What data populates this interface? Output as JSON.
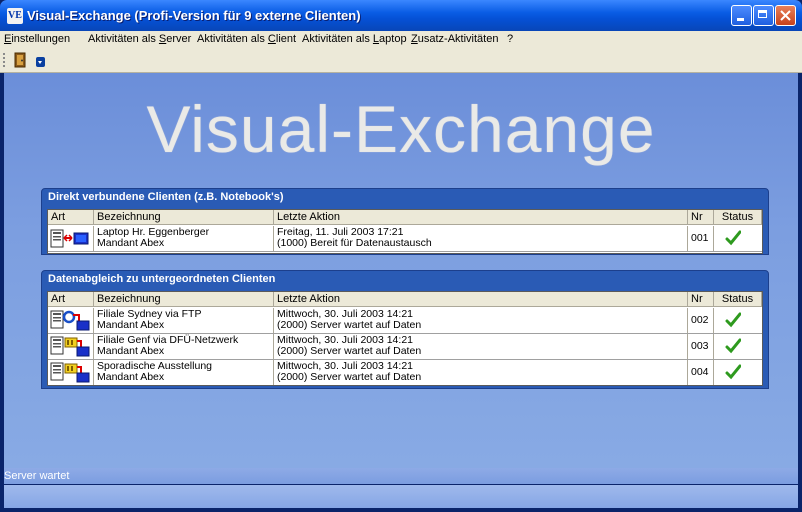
{
  "window": {
    "title": "Visual-Exchange (Profi-Version für 9 externe Clienten)",
    "app_icon_text": "VE"
  },
  "menu": [
    {
      "pre": "",
      "u": "E",
      "post": "instellungen"
    },
    {
      "pre": "Aktivitäten als ",
      "u": "S",
      "post": "erver"
    },
    {
      "pre": "Aktivitäten als ",
      "u": "C",
      "post": "lient"
    },
    {
      "pre": "Aktivitäten als ",
      "u": "L",
      "post": "aptop"
    },
    {
      "pre": "",
      "u": "Z",
      "post": "usatz-Aktivitäten"
    },
    {
      "pre": "",
      "u": "",
      "post": "?"
    }
  ],
  "watermark": "Visual-Exchange",
  "panel1": {
    "title": "Direkt verbundene Clienten (z.B. Notebook's)",
    "headers": [
      "Art",
      "Bezeichnung",
      "Letzte Aktion",
      "Nr",
      "Status"
    ],
    "rows": [
      {
        "name1": "Laptop Hr. Eggenberger",
        "name2": "Mandant Abex",
        "action1": "Freitag, 11. Juli 2003 17:21",
        "action2": "(1000) Bereit für Datenaustausch",
        "nr": "001",
        "icon": "laptop-link-icon"
      }
    ]
  },
  "panel2": {
    "title": "Datenabgleich zu untergeordneten Clienten",
    "headers": [
      "Art",
      "Bezeichnung",
      "Letzte Aktion",
      "Nr",
      "Status"
    ],
    "rows": [
      {
        "name1": "Filiale Sydney via FTP",
        "name2": "Mandant Abex",
        "action1": "Mittwoch, 30. Juli 2003 14:21",
        "action2": "(2000) Server wartet auf Daten",
        "nr": "002",
        "icon": "ftp-sync-icon"
      },
      {
        "name1": "Filiale Genf via DFÜ-Netzwerk",
        "name2": "Mandant Abex",
        "action1": "Mittwoch, 30. Juli 2003 14:21",
        "action2": "(2000) Server wartet auf Daten",
        "nr": "003",
        "icon": "dialup-sync-icon"
      },
      {
        "name1": "Sporadische Ausstellung",
        "name2": "Mandant Abex",
        "action1": "Mittwoch, 30. Juli 2003 14:21",
        "action2": "(2000) Server wartet auf Daten",
        "nr": "004",
        "icon": "dialup-sync-icon"
      }
    ]
  },
  "status": {
    "text": "Server wartet"
  },
  "colors": {
    "title_bar": "#0551d6",
    "main_bg": "#7c9ee0",
    "panel_bg": "#2a5bb5",
    "check": "#2e9a1e"
  }
}
